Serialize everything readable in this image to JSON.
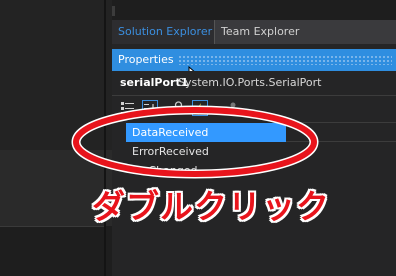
{
  "tabs": {
    "solution_explorer": "Solution Explorer",
    "team_explorer": "Team Explorer"
  },
  "properties": {
    "title": "Properties",
    "object_name": "serialPort1",
    "object_type": "System.IO.Ports.SerialPort"
  },
  "toolbar": {
    "icons": [
      "categorized-icon",
      "alphabetical-icon",
      "properties-icon",
      "events-icon",
      "property-pages-icon"
    ]
  },
  "events": [
    {
      "label": "DataReceived",
      "selected": true
    },
    {
      "label": "ErrorReceived",
      "selected": false
    },
    {
      "label": "PinChanged",
      "selected": false
    }
  ],
  "annotation": {
    "text": "ダブルクリック",
    "color": "#e8141c"
  },
  "colors": {
    "accent": "#2f8ee0",
    "selection": "#3399ff",
    "highlight_ring": "#e8141c"
  }
}
